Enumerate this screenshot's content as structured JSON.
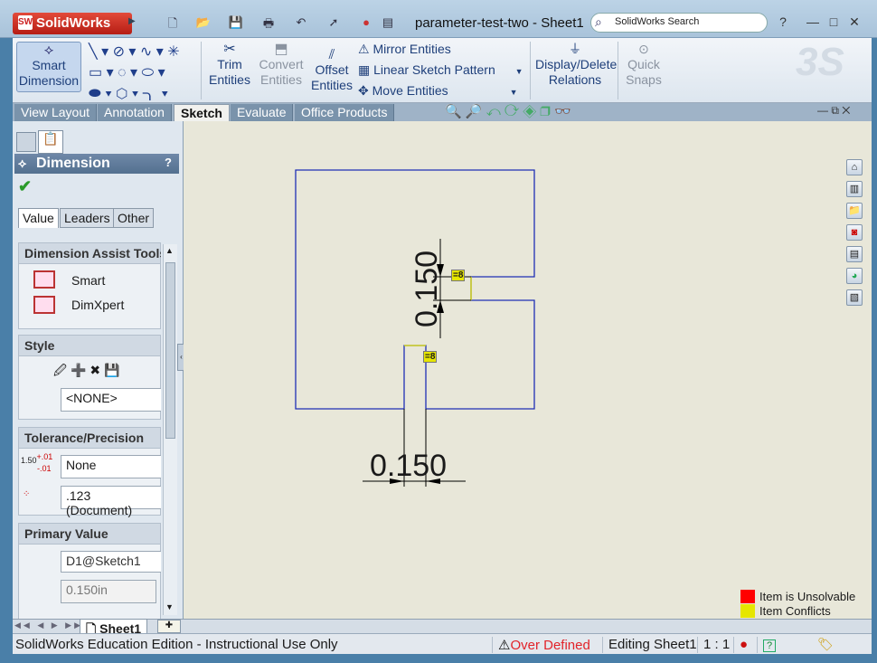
{
  "app": {
    "title": "SolidWorks",
    "document_title": "parameter-test-two - Sheet1",
    "search_placeholder": "SolidWorks Search"
  },
  "ribbon": {
    "smart_dimension": "Smart Dimension",
    "trim_entities": "Trim Entities",
    "convert_entities": "Convert Entities",
    "offset_entities": "Offset Entities",
    "mirror_entities": "Mirror Entities",
    "linear_sketch_pattern": "Linear Sketch Pattern",
    "move_entities": "Move Entities",
    "display_delete_relations": "Display/Delete Relations",
    "quick_snaps": "Quick Snaps"
  },
  "tabs": [
    "View Layout",
    "Annotation",
    "Sketch",
    "Evaluate",
    "Office Products"
  ],
  "active_tab": "Sketch",
  "property_manager": {
    "title": "Dimension",
    "help": "?",
    "tabs": [
      "Value",
      "Leaders",
      "Other"
    ],
    "assist_tools": {
      "title": "Dimension Assist Tools",
      "items": [
        "Smart",
        "DimXpert"
      ]
    },
    "style": {
      "title": "Style",
      "value": "<NONE>"
    },
    "tolerance": {
      "title": "Tolerance/Precision",
      "icon_text_main": "1.50",
      "icon_text_plus": "+.01",
      "icon_text_minus": "-.01",
      "type": "None",
      "precision": ".123 (Document)"
    },
    "primary_value": {
      "title": "Primary Value",
      "name": "D1@Sketch1",
      "value": "0.150in"
    }
  },
  "drawing": {
    "vertical_dimension": "0.150",
    "horizontal_dimension": "0.150",
    "relation_badge_1": "=8",
    "relation_badge_2": "=8"
  },
  "legend": {
    "unsolvable": "Item is Unsolvable",
    "conflicts": "Item Conflicts",
    "unsolvable_color": "#ff0000",
    "conflicts_color": "#e6e600"
  },
  "sheet_tab": "Sheet1",
  "status": {
    "edition": "SolidWorks Education Edition - Instructional Use Only",
    "over_defined": "Over Defined",
    "editing": "Editing Sheet1",
    "scale": "1 : 1",
    "help": "?"
  }
}
